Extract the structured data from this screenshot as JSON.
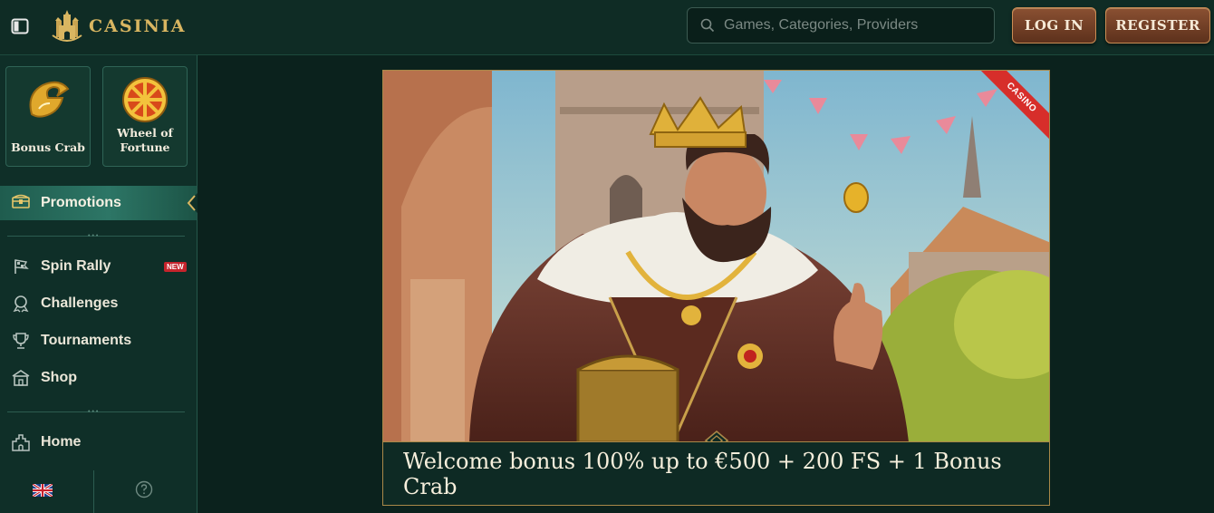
{
  "header": {
    "logo_text": "CASINIA",
    "search_placeholder": "Games, Categories, Providers",
    "login_label": "LOG IN",
    "register_label": "REGISTER"
  },
  "sidebar": {
    "tiles": [
      {
        "label": "Bonus Crab",
        "icon": "crab-claw-icon"
      },
      {
        "label": "Wheel of Fortune",
        "icon": "wheel-icon"
      }
    ],
    "promotions_label": "Promotions",
    "items": [
      {
        "label": "Spin Rally",
        "icon": "checkered-flag-icon",
        "badge": "NEW"
      },
      {
        "label": "Challenges",
        "icon": "medal-icon"
      },
      {
        "label": "Tournaments",
        "icon": "trophy-icon"
      },
      {
        "label": "Shop",
        "icon": "shop-icon"
      }
    ],
    "home_label": "Home",
    "language_icon": "uk-flag-icon",
    "help_icon": "help-icon"
  },
  "banner": {
    "ribbon": "CASINO",
    "caption": "Welcome bonus 100% up to €500 + 200 FS + 1 Bonus Crab"
  },
  "colors": {
    "bg": "#0d2620",
    "gold": "#d9b661",
    "button": "#7a4328",
    "sidebar_active": "#2d7666",
    "badge": "#c6242c"
  }
}
